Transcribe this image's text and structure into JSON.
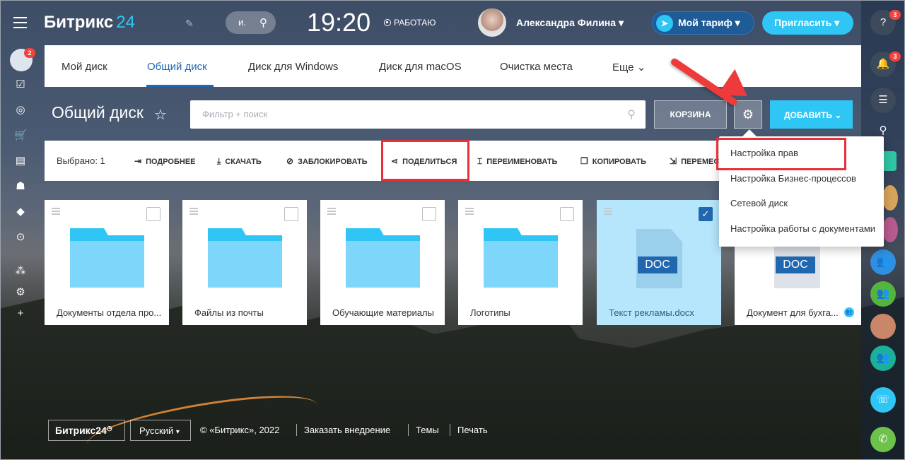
{
  "header": {
    "logo_text": "Битрикс",
    "logo_num": "24",
    "search_label": "и.",
    "clock": "19:20",
    "status": "РАБОТАЮ",
    "user_name": "Александра Филина",
    "tariff_label": "Мой тариф",
    "invite_label": "Пригласить"
  },
  "leftbar": {
    "badge": "2"
  },
  "rightbar": {
    "badge_help": "3",
    "badge_notify": "3"
  },
  "tabs": [
    {
      "label": "Мой диск"
    },
    {
      "label": "Общий диск"
    },
    {
      "label": "Диск для Windows"
    },
    {
      "label": "Диск для macOS"
    },
    {
      "label": "Очистка места"
    },
    {
      "label": "Еще"
    }
  ],
  "toolbar": {
    "title": "Общий диск",
    "filter_placeholder": "Фильтр + поиск",
    "trash_label": "КОРЗИНА",
    "add_label": "ДОБАВИТЬ"
  },
  "actions": {
    "selected": "Выбрано: 1",
    "items": [
      {
        "label": "ПОДРОБНЕЕ"
      },
      {
        "label": "СКАЧАТЬ"
      },
      {
        "label": "ЗАБЛОКИРОВАТЬ"
      },
      {
        "label": "ПОДЕЛИТЬСЯ"
      },
      {
        "label": "ПЕРЕИМЕНОВАТЬ"
      },
      {
        "label": "КОПИРОВАТЬ"
      },
      {
        "label": "ПЕРЕМЕС"
      }
    ]
  },
  "settings_menu": [
    {
      "label": "Настройка прав"
    },
    {
      "label": "Настройка Бизнес-процессов"
    },
    {
      "label": "Сетевой диск"
    },
    {
      "label": "Настройка работы с документами"
    }
  ],
  "files": [
    {
      "name": "Документы отдела про...",
      "type": "folder",
      "selected": false
    },
    {
      "name": "Файлы из почты",
      "type": "folder",
      "selected": false
    },
    {
      "name": "Обучающие материалы",
      "type": "folder",
      "selected": false
    },
    {
      "name": "Логотипы",
      "type": "folder",
      "selected": false
    },
    {
      "name": "Текст рекламы.docx",
      "type": "doc",
      "selected": true,
      "badge": "DOC"
    },
    {
      "name": "Документ для бухга...",
      "type": "doc",
      "selected": false,
      "badge": "DOC"
    }
  ],
  "footer": {
    "logo": "Битрикс24",
    "language": "Русский",
    "copyright": "© «Битрикс», 2022",
    "order": "Заказать внедрение",
    "themes": "Темы",
    "print": "Печать"
  },
  "colors": {
    "accent": "#2fc6f6",
    "primary": "#2067b0",
    "highlight": "#e8303a"
  }
}
